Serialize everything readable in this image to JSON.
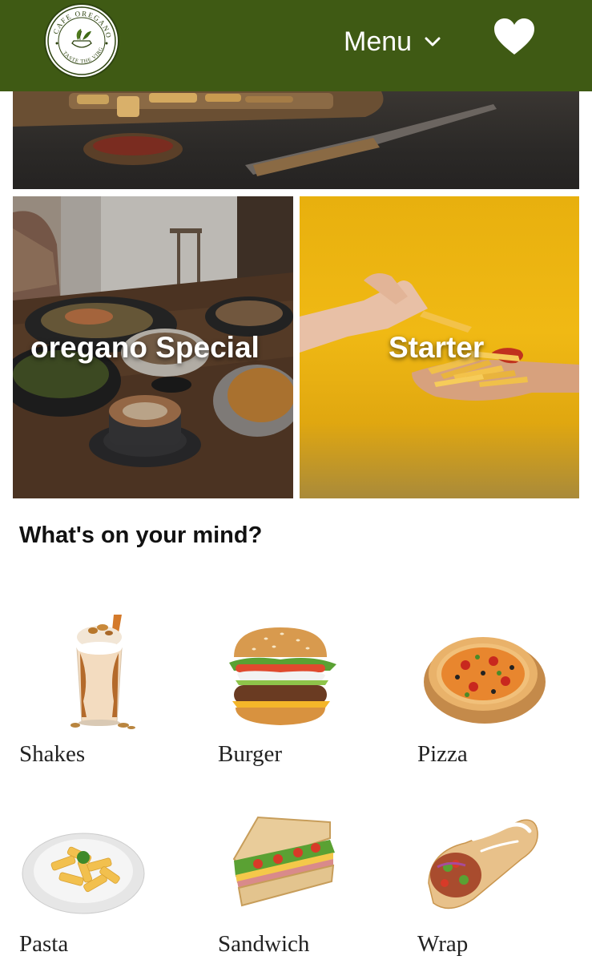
{
  "header": {
    "logo_text_top": "CAFE OREGANO",
    "logo_text_bottom": "TASTE THE VIRGIN",
    "menu_label": "Menu",
    "menu_icon": "chevron-down-icon",
    "favorite_icon": "heart-icon",
    "background_color": "#3f5a14"
  },
  "feature_tiles": [
    {
      "title": "oregano Special"
    },
    {
      "title": "Starter"
    }
  ],
  "categories_section": {
    "title": "What's on your mind?",
    "items": [
      {
        "label": "Shakes"
      },
      {
        "label": "Burger"
      },
      {
        "label": "Pizza"
      },
      {
        "label": "Pasta"
      },
      {
        "label": "Sandwich"
      },
      {
        "label": "Wrap"
      }
    ]
  }
}
